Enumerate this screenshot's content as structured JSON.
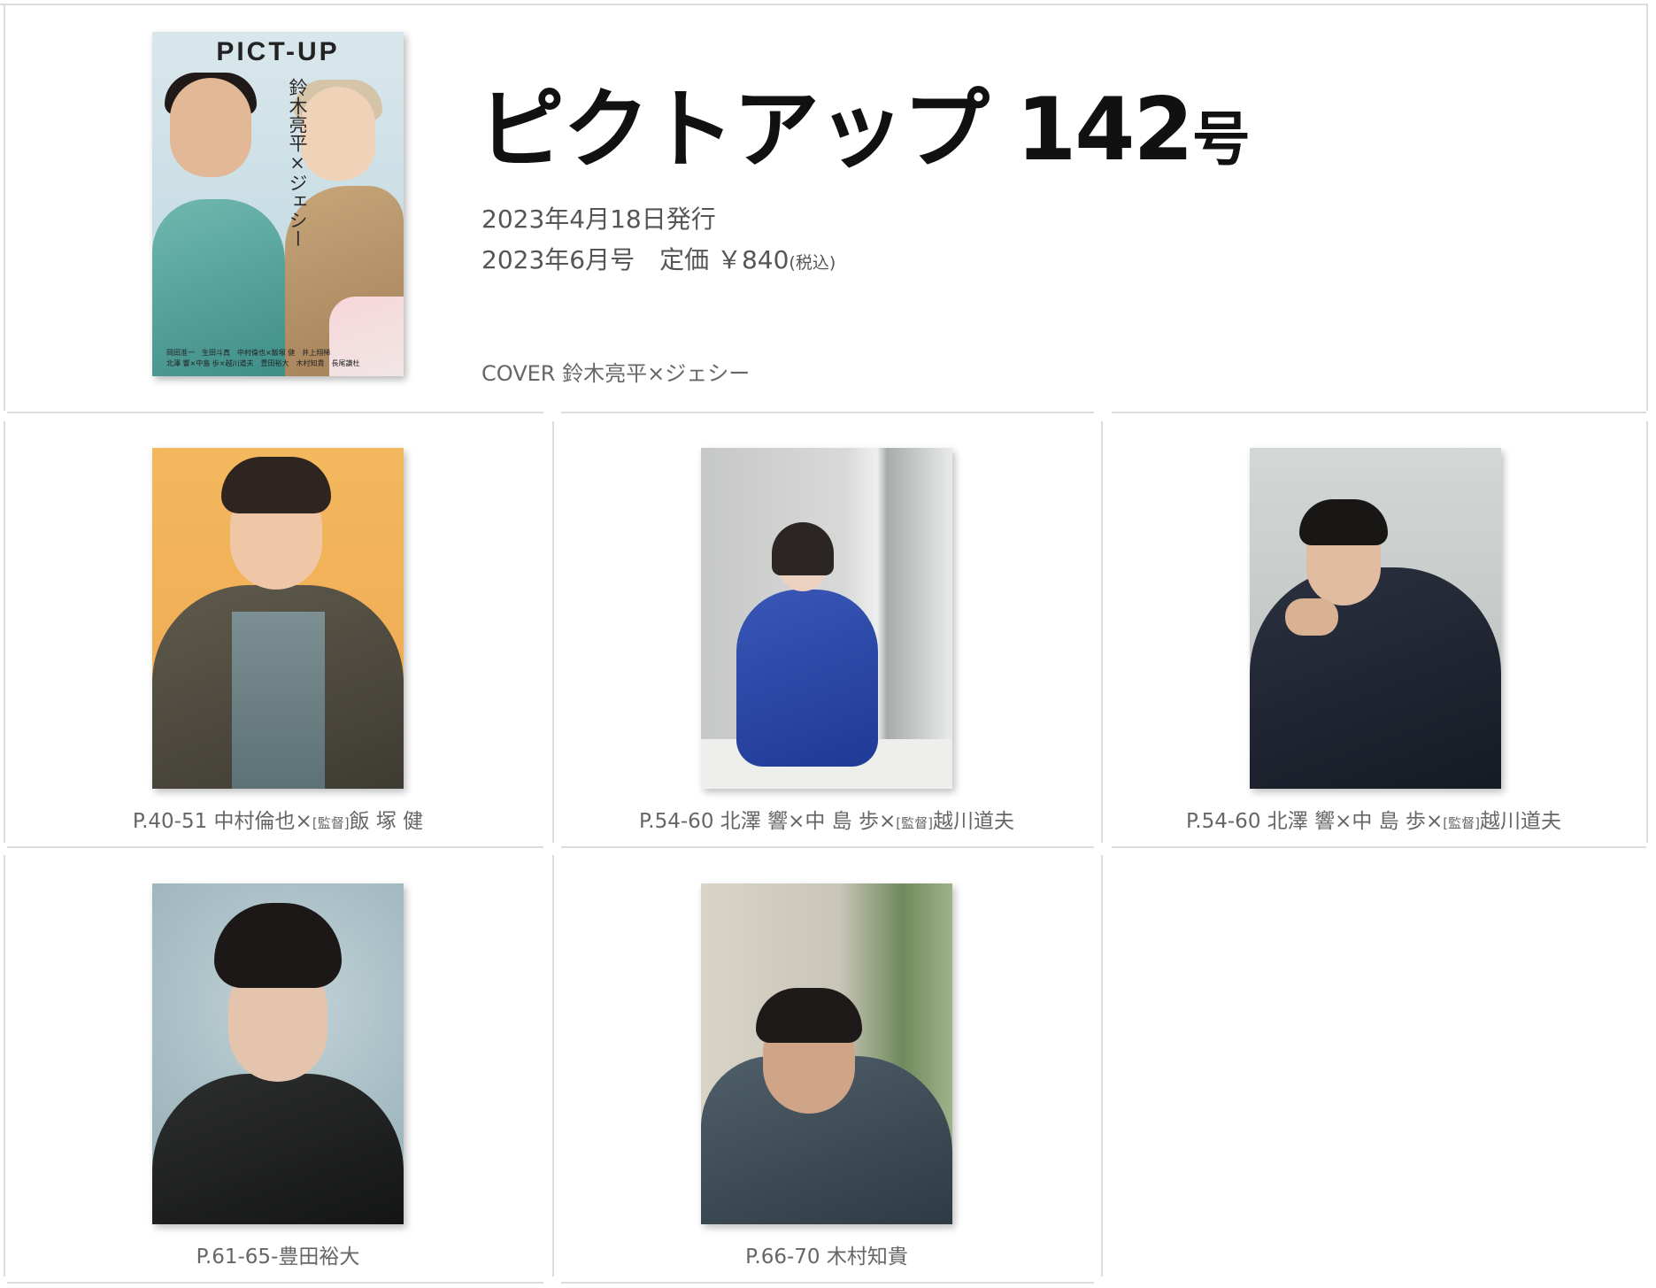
{
  "issue": {
    "title_main": "ピクトアップ 142",
    "title_suffix": "号",
    "published": "2023年4月18日発行",
    "price_line": "2023年6月号　定価 ￥840",
    "price_tax": "(税込)",
    "cover_caption": "COVER 鈴木亮平×ジェシー"
  },
  "cover_image": {
    "logo": "PICT-UP",
    "tagline": "鈴木亮平×ジェシー",
    "credits_line1": "岡田准一　生田斗真　中村倫也×飯塚 健　井上翔稀",
    "credits_line2": "北澤 響×中島 歩×越川道夫　豊田裕大　木村知貴　長尾謙杜"
  },
  "articles": [
    {
      "pages": "P.40-51",
      "names_before": " 中村倫也×",
      "director_tag": "[監督]",
      "names_after": "飯 塚 健"
    },
    {
      "pages": "P.54-60",
      "names_before": " 北澤 響×中 島 歩×",
      "director_tag": "[監督]",
      "names_after": "越川道夫"
    },
    {
      "pages": "P.54-60",
      "names_before": " 北澤 響×中 島 歩×",
      "director_tag": "[監督]",
      "names_after": "越川道夫"
    },
    {
      "pages": "P.61-65-",
      "names_before": "豊田裕大",
      "director_tag": "",
      "names_after": ""
    },
    {
      "pages": "P.66-70",
      "names_before": " 木村知貴",
      "director_tag": "",
      "names_after": ""
    }
  ],
  "colors": {
    "photo1_bg": "#f1b35a",
    "photo2_bg": "#c9cac9",
    "photo3_bg": "#c4c8c6",
    "photo4_bg": "#a9c1c7",
    "photo5_bg": "#c7cbbf"
  }
}
